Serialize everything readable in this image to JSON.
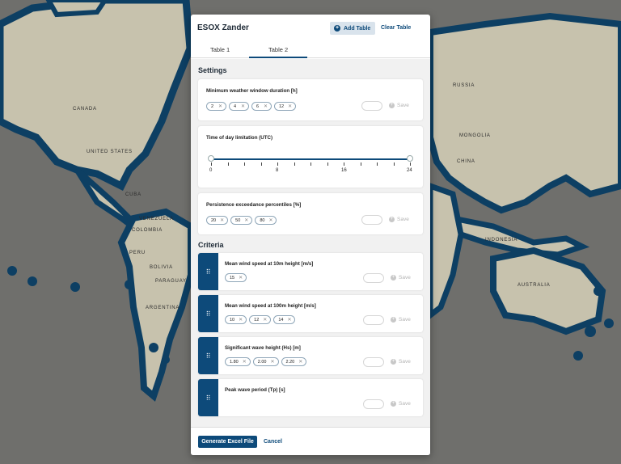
{
  "map": {
    "labels": {
      "canada": "CANADA",
      "united_states": "UNITED STATES",
      "venezuela": "VENEZUELA",
      "colombia": "COLOMBIA",
      "peru": "PERU",
      "bolivia": "BOLIVIA",
      "paraguay": "PARAGUAY",
      "argentina": "ARGENTINA",
      "cuba": "CUBA",
      "russia": "RUSSIA",
      "mongolia": "MONGOLIA",
      "china": "CHINA",
      "indonesia": "INDONESIA",
      "australia": "AUSTRALIA"
    },
    "colors": {
      "ocean": "#6f6f6c",
      "land": "#c7c2ad",
      "coast": "#0d3f63"
    }
  },
  "modal": {
    "title": "ESOX Zander",
    "add_table_label": "Add Table",
    "clear_table_label": "Clear Table",
    "tabs": [
      {
        "label": "Table 1",
        "active": false
      },
      {
        "label": "Table 2",
        "active": true
      }
    ],
    "settings": {
      "title": "Settings",
      "weather_window": {
        "title": "Minimum weather window duration [h]",
        "chips": [
          "2",
          "4",
          "6",
          "12"
        ],
        "save_label": "Save"
      },
      "time_of_day": {
        "title": "Time of day limitation (UTC)",
        "range": [
          0,
          24
        ],
        "tick_labels": [
          "0",
          "8",
          "16",
          "24"
        ]
      },
      "persistence": {
        "title": "Persistence exceedance percentiles [%]",
        "chips": [
          "20",
          "50",
          "80"
        ],
        "save_label": "Save"
      }
    },
    "criteria": {
      "title": "Criteria",
      "items": [
        {
          "title": "Mean wind speed at 10m height [m/s]",
          "chips": [
            "15"
          ],
          "save_label": "Save"
        },
        {
          "title": "Mean wind speed at 100m height [m/s]",
          "chips": [
            "10",
            "12",
            "14"
          ],
          "save_label": "Save"
        },
        {
          "title": "Significant wave height (Hs) [m]",
          "chips": [
            "1.80",
            "2.00",
            "2.20"
          ],
          "save_label": "Save"
        },
        {
          "title": "Peak wave period (Tp) [s]",
          "chips": [],
          "save_label": "Save"
        }
      ]
    },
    "footer": {
      "generate_label": "Generate Excel File",
      "cancel_label": "Cancel"
    },
    "accent_color": "#0d4a7a"
  }
}
